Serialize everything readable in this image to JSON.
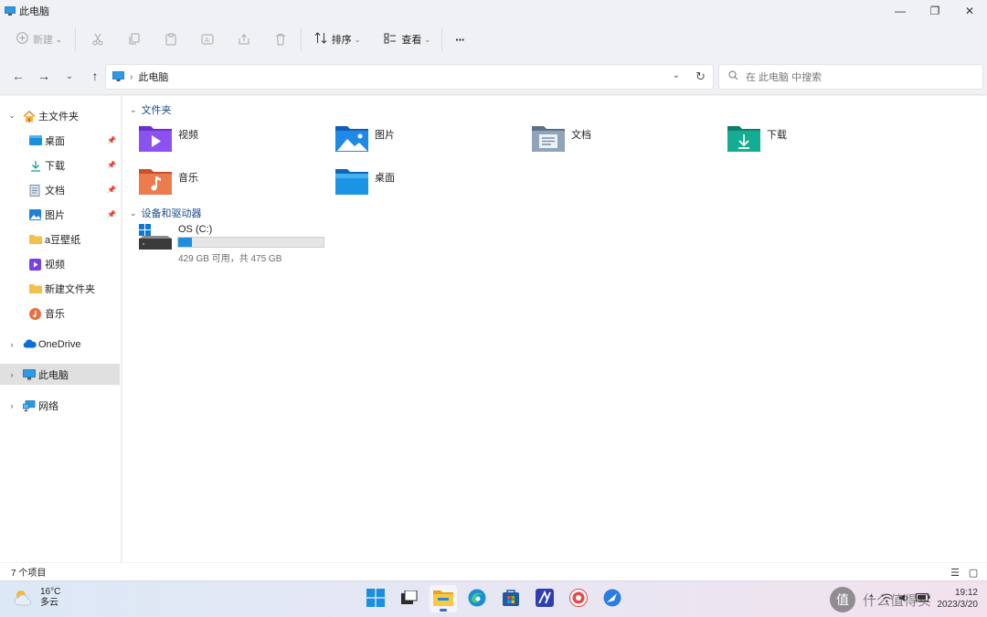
{
  "window": {
    "title": "此电脑",
    "controls": {
      "minimize": "—",
      "maximize": "❐",
      "close": "✕"
    }
  },
  "toolbar": {
    "new_label": "新建",
    "sort_label": "排序",
    "view_label": "查看",
    "more_label": "···"
  },
  "address": {
    "crumb": "此电脑",
    "search_placeholder": "在 此电脑 中搜索"
  },
  "sidebar": {
    "home": "主文件夹",
    "quick": [
      {
        "label": "桌面",
        "pinned": true,
        "icon": "desktop-icon"
      },
      {
        "label": "下载",
        "pinned": true,
        "icon": "download-icon"
      },
      {
        "label": "文档",
        "pinned": true,
        "icon": "document-icon"
      },
      {
        "label": "图片",
        "pinned": true,
        "icon": "pictures-icon"
      },
      {
        "label": "a豆壁纸",
        "pinned": false,
        "icon": "folder-icon"
      },
      {
        "label": "视频",
        "pinned": false,
        "icon": "video-icon"
      },
      {
        "label": "新建文件夹",
        "pinned": false,
        "icon": "folder-icon"
      },
      {
        "label": "音乐",
        "pinned": false,
        "icon": "music-icon"
      }
    ],
    "onedrive": "OneDrive",
    "thispc": "此电脑",
    "network": "网络"
  },
  "main": {
    "folders_header": "文件夹",
    "folders": [
      {
        "label": "视频",
        "icon": "videos-folder-icon",
        "color": "#7b3fe4"
      },
      {
        "label": "图片",
        "icon": "pictures-folder-icon",
        "color": "#1e7fd8"
      },
      {
        "label": "文档",
        "icon": "documents-folder-icon",
        "color": "#7a8fa8"
      },
      {
        "label": "下载",
        "icon": "downloads-folder-icon",
        "color": "#12a38a"
      },
      {
        "label": "音乐",
        "icon": "music-folder-icon",
        "color": "#e8713f"
      },
      {
        "label": "桌面",
        "icon": "desktop-folder-icon",
        "color": "#1a8fe0"
      }
    ],
    "drives_header": "设备和驱动器",
    "drive": {
      "name": "OS (C:)",
      "free_text": "429 GB 可用，共 475 GB",
      "used_fraction": 0.097
    }
  },
  "status": {
    "count": "7 个项目"
  },
  "taskbar": {
    "temp": "16°C",
    "condition": "多云",
    "time": "19:12",
    "date": "2023/3/20",
    "watermark": "什么值得买",
    "watermark_badge": "值"
  },
  "colors": {
    "accent": "#1f8ee0",
    "folder_yellow": "#f5c04a"
  }
}
